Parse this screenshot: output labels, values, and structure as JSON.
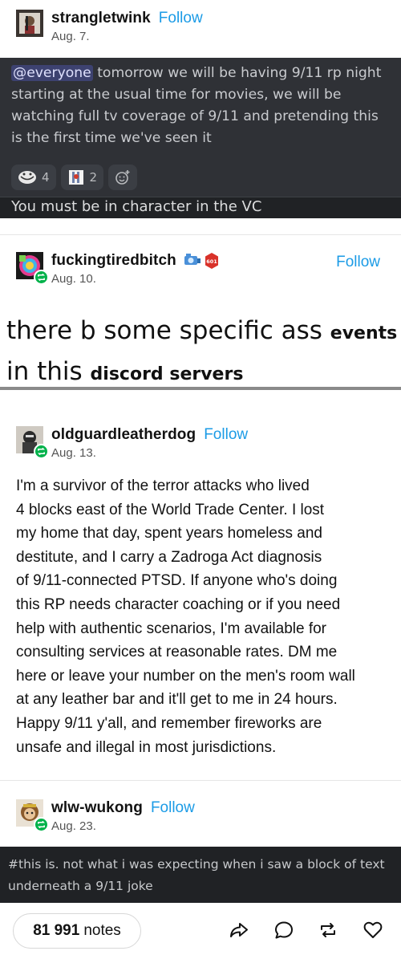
{
  "posts": [
    {
      "username": "strangletwink",
      "follow_label": "Follow",
      "date": "Aug. 7.",
      "discord": {
        "mention": "@everyone",
        "message_lines": [
          " tomorrow we will be having 9/11 rp night",
          "starting at the usual time for movies, we will be",
          "watching full tv coverage of 9/11 and pretending this",
          "is the first time we've seen it"
        ],
        "reactions": [
          {
            "icon": "troll-face-emoji",
            "count": "4"
          },
          {
            "icon": "twin-towers-emoji",
            "count": "2"
          },
          {
            "icon": "add-reaction-icon",
            "count": ""
          }
        ],
        "footer_text": "You must be in character in the VC"
      }
    },
    {
      "username": "fuckingtiredbitch",
      "follow_label": "Follow",
      "date": "Aug. 10.",
      "badge_text": "601",
      "big_text": {
        "line1_large": "there b some specific ass ",
        "line1_small": "events",
        "line2_large": "in this ",
        "line2_small": "discord servers"
      }
    },
    {
      "username": "oldguardleatherdog",
      "follow_label": "Follow",
      "date": "Aug. 13.",
      "body_lines": [
        "I'm a survivor of the terror attacks who lived",
        "4 blocks east of the World Trade Center. I lost",
        "my home that day, spent years homeless and",
        "destitute, and I carry a Zadroga Act diagnosis",
        "of 9/11-connected PTSD. If anyone who's doing",
        "this RP needs character coaching or if you need",
        "help with authentic scenarios, I'm available for",
        "consulting services at reasonable rates. DM me",
        "here or leave your number on the men's room wall",
        "at any leather bar and it'll get to me in 24 hours.",
        "Happy 9/11 y'all, and remember fireworks are",
        "unsafe and illegal in most jurisdictions."
      ]
    },
    {
      "username": "wlw-wukong",
      "follow_label": "Follow",
      "date": "Aug. 23.",
      "tags_lines": [
        "#this is. not what i was expecting when i saw a block of text",
        "underneath a 9/11 joke"
      ]
    }
  ],
  "footer": {
    "notes_count": "81 991",
    "notes_label": "notes",
    "actions": [
      "share-icon",
      "reply-icon",
      "reblog-icon",
      "like-icon"
    ]
  },
  "colors": {
    "follow": "#1b9be6",
    "reblog_badge": "#00b24a",
    "discord_bg": "#2f3136",
    "discord_dark": "#202225"
  }
}
